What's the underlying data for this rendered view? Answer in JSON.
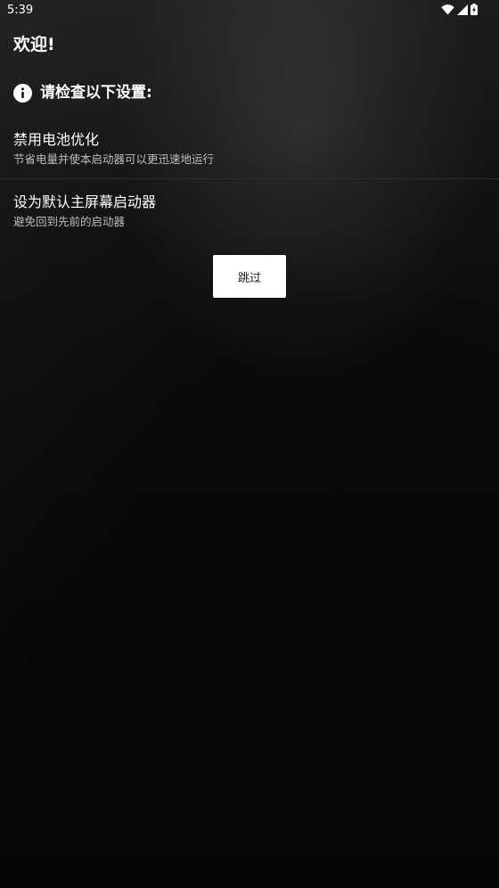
{
  "status_bar": {
    "time": "5:39",
    "icons": [
      "wifi-icon",
      "cell-signal-icon",
      "battery-icon"
    ]
  },
  "welcome": {
    "title": "欢迎!",
    "check_prompt": "请检查以下设置:"
  },
  "settings": [
    {
      "title": "禁用电池优化",
      "subtitle": "节省电量并使本启动器可以更迅速地运行"
    },
    {
      "title": "设为默认主屏幕启动器",
      "subtitle": "避免回到先前的启动器"
    }
  ],
  "actions": {
    "skip_label": "跳过"
  },
  "colors": {
    "background": "#060606",
    "text_primary": "#ffffff",
    "text_secondary": "#bdbdbd",
    "button_bg": "#ffffff",
    "button_text": "#222222"
  }
}
